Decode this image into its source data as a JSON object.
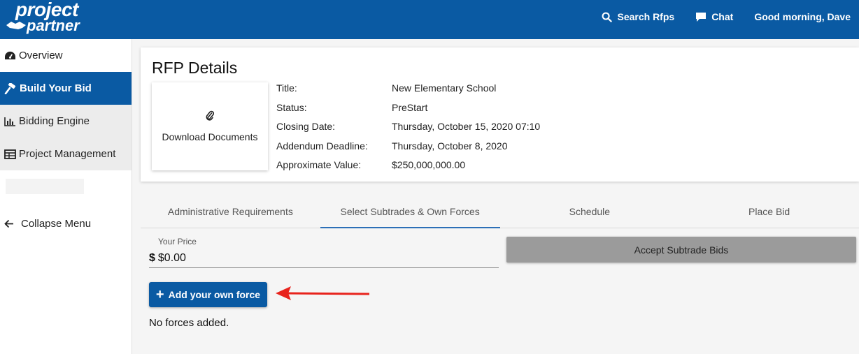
{
  "brand": {
    "line1": "project",
    "line2": "partner"
  },
  "topnav": {
    "search_label": "Search Rfps",
    "chat_label": "Chat",
    "greeting": "Good morning, Dave"
  },
  "sidebar": {
    "items": [
      {
        "label": "Overview",
        "icon": "dashboard-icon"
      },
      {
        "label": "Build Your Bid",
        "icon": "hammer-icon"
      },
      {
        "label": "Bidding Engine",
        "icon": "bar-chart-icon"
      },
      {
        "label": "Project Management",
        "icon": "table-icon"
      }
    ],
    "collapse_label": "Collapse Menu"
  },
  "rfp": {
    "heading": "RFP Details",
    "download_label": "Download Documents",
    "fields": [
      {
        "key": "Title:",
        "value": "New Elementary School"
      },
      {
        "key": "Status:",
        "value": "PreStart"
      },
      {
        "key": "Closing Date:",
        "value": "Thursday, October 15, 2020 07:10"
      },
      {
        "key": "Addendum Deadline:",
        "value": "Thursday, October 8, 2020"
      },
      {
        "key": "Approximate Value:",
        "value": "$250,000,000.00"
      }
    ]
  },
  "tabs": [
    {
      "label": "Administrative Requirements"
    },
    {
      "label": "Select Subtrades & Own Forces"
    },
    {
      "label": "Schedule"
    },
    {
      "label": "Place Bid"
    }
  ],
  "bid": {
    "price_label": "Your Price",
    "currency": "$",
    "price_value": "$0.00",
    "accept_label": "Accept Subtrade Bids",
    "add_force_label": "Add your own force",
    "empty_text": "No forces added."
  },
  "colors": {
    "primary": "#0a5aa3",
    "arrow": "#e8231c",
    "disabled_button": "#9b9b9b"
  }
}
